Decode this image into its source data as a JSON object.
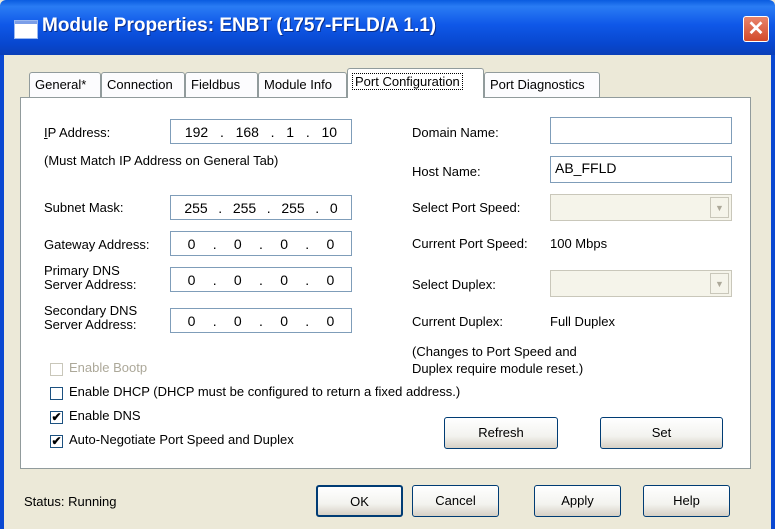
{
  "window": {
    "title": "Module Properties: ENBT (1757-FFLD/A 1.1)",
    "close": "✕"
  },
  "tabs": [
    "General*",
    "Connection",
    "Fieldbus",
    "Module Info",
    "Port Configuration",
    "Port Diagnostics"
  ],
  "active_tab": "Port Configuration",
  "left": {
    "ip_label": "IP Address:",
    "ip_value": [
      "192",
      "168",
      "1",
      "10"
    ],
    "ip_note": "(Must Match IP Address on General Tab)",
    "subnet_label": "Subnet Mask:",
    "subnet_value": [
      "255",
      "255",
      "255",
      "0"
    ],
    "gateway_label": "Gateway Address:",
    "gateway_value": [
      "0",
      "0",
      "0",
      "0"
    ],
    "primary_dns_label_1": "Primary DNS",
    "primary_dns_label_2": "Server Address:",
    "primary_dns_value": [
      "0",
      "0",
      "0",
      "0"
    ],
    "secondary_dns_label_1": "Secondary DNS",
    "secondary_dns_label_2": "Server Address:",
    "secondary_dns_value": [
      "0",
      "0",
      "0",
      "0"
    ]
  },
  "right": {
    "domain_label": "Domain Name:",
    "domain_value": "",
    "host_label": "Host Name:",
    "host_value": "AB_FFLD",
    "port_speed_label": "Select Port Speed:",
    "current_speed_label": "Current Port Speed:",
    "current_speed_value": "100 Mbps",
    "duplex_label": "Select Duplex:",
    "current_duplex_label": "Current Duplex:",
    "current_duplex_value": "Full Duplex",
    "note_1": "(Changes to Port Speed and",
    "note_2": "Duplex require module reset.)"
  },
  "checkboxes": {
    "bootp": {
      "label": "Enable Bootp",
      "checked": false,
      "enabled": false
    },
    "dhcp": {
      "label": "Enable DHCP  (DHCP must be configured to return a fixed address.)",
      "checked": false,
      "enabled": true
    },
    "dns": {
      "label": "Enable DNS",
      "checked": true,
      "enabled": true
    },
    "autoneg": {
      "label": "Auto-Negotiate Port Speed and Duplex",
      "checked": true,
      "enabled": true
    }
  },
  "buttons": {
    "refresh": "Refresh",
    "set": "Set",
    "ok": "OK",
    "cancel": "Cancel",
    "apply": "Apply",
    "help": "Help"
  },
  "status": {
    "label": "Status:",
    "value": "Running"
  }
}
